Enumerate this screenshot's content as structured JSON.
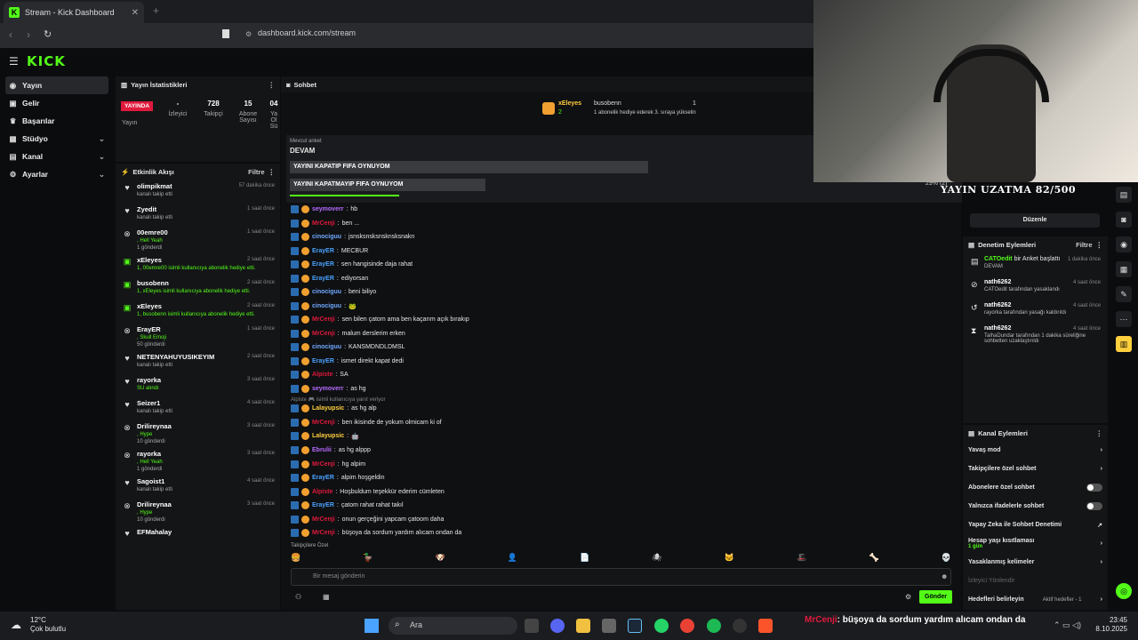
{
  "browser": {
    "tab_title": "Stream - Kick Dashboard",
    "url": "dashboard.kick.com/stream"
  },
  "brand": {
    "logo": "KICK",
    "accent": "#53fc18"
  },
  "nav": [
    {
      "label": "Yayın",
      "icon": "broadcast-icon",
      "active": true
    },
    {
      "label": "Gelir",
      "icon": "money-icon"
    },
    {
      "label": "Başarılar",
      "icon": "trophy-icon"
    },
    {
      "label": "Stüdyo",
      "icon": "studio-icon",
      "chevron": true
    },
    {
      "label": "Kanal",
      "icon": "channel-icon",
      "chevron": true
    },
    {
      "label": "Ayarlar",
      "icon": "gear-icon",
      "chevron": true
    }
  ],
  "stats": {
    "title": "Yayın İstatistikleri",
    "live_label": "YAYINDA",
    "live_sub": "Yayın",
    "viewers": {
      "value": "-",
      "label": "İzleyici"
    },
    "followers": {
      "value": "728",
      "label": "Takipçi"
    },
    "subs": {
      "value": "15",
      "label": "Abone Sayısı"
    },
    "extra": {
      "value": "04",
      "label": "Ya Ol Sü"
    }
  },
  "feed": {
    "title": "Etkinlik Akışı",
    "filter": "Filtre",
    "items": [
      {
        "name": "olimpikmat",
        "time": "57 dakika önce",
        "desc": "kanalı takip etti",
        "icon": "heart-icon"
      },
      {
        "name": "Zyedit",
        "time": "1 saat önce",
        "desc": "kanalı takip etti",
        "icon": "heart-icon"
      },
      {
        "name": "00emre00",
        "time": "1 saat önce",
        "desc": ", Hell Yeah",
        "extra": "1 gönderdi",
        "icon": "kick-icon",
        "green": true
      },
      {
        "name": "xEleyes",
        "time": "2 saat önce",
        "desc": "1, 00emre00 isimli kullanıcıya abonelik hediye etti.",
        "icon": "gift-icon",
        "green": true
      },
      {
        "name": "busobenn",
        "time": "2 saat önce",
        "desc": "1, xEleyes isimli kullanıcıya abonelik hediye etti.",
        "icon": "gift-icon",
        "green": true
      },
      {
        "name": "xEleyes",
        "time": "2 saat önce",
        "desc": "1, busobenn isimli kullanıcıya abonelik hediye etti.",
        "icon": "gift-icon",
        "green": true
      },
      {
        "name": "ErayER",
        "time": "1 saat önce",
        "desc": ", Skull Emoji",
        "extra": "50 gönderdi",
        "icon": "kick-icon",
        "green": true
      },
      {
        "name": "NETENYAHUYUSIKEYIM",
        "time": "2 saat önce",
        "desc": "kanalı takip etti",
        "icon": "heart-icon"
      },
      {
        "name": "rayorka",
        "time": "3 saat önce",
        "desc": "SU alındı",
        "icon": "heart-icon",
        "green": true
      },
      {
        "name": "Seizer1",
        "time": "4 saat önce",
        "desc": "kanalı takip etti",
        "icon": "heart-icon"
      },
      {
        "name": "Drilireynaa",
        "time": "3 saat önce",
        "desc": ", Hype",
        "extra": "10 gönderdi",
        "icon": "kick-icon",
        "green": true
      },
      {
        "name": "rayorka",
        "time": "3 saat önce",
        "desc": ", Hell Yeah",
        "extra": "1 gönderdi",
        "icon": "kick-icon",
        "green": true
      },
      {
        "name": "Sagoist1",
        "time": "4 saat önce",
        "desc": "kanalı takip etti",
        "icon": "heart-icon"
      },
      {
        "name": "Drilireynaa",
        "time": "3 saat önce",
        "desc": ", Hype",
        "extra": "10 gönderdi",
        "icon": "kick-icon",
        "green": true
      },
      {
        "name": "EFMahalay",
        "time": "",
        "desc": "",
        "icon": "heart-icon"
      }
    ]
  },
  "chat": {
    "title": "Sohbet",
    "pinned": {
      "user1": "xEleyes",
      "count1": "2",
      "user2": "busobenn",
      "count2": "1",
      "desc": "1 abonelik hediye ederek 3. sıraya yükselin"
    },
    "poll": {
      "label": "Mevcut anket",
      "status": "DEVAM",
      "opt1": "YAYINI KAPATIP FIFA OYNUYOM",
      "opt1_pct": 0.68,
      "opt2": "YAYINI KAPATMAYIP FIFA OYNUYOM",
      "opt2_pct": 0.29,
      "pct_label": "29% (2)"
    },
    "messages": [
      {
        "user": "seymoverr",
        "color": "#b56cff",
        "text": "hb"
      },
      {
        "user": "MrCenji",
        "color": "#e0193c",
        "text": "ben ..."
      },
      {
        "user": "cinociguu",
        "color": "#6fa8ff",
        "text": "jsnsksnsksnsknsksnakn"
      },
      {
        "user": "ErayER",
        "color": "#4aa3ff",
        "text": "MECBUR"
      },
      {
        "user": "ErayER",
        "color": "#4aa3ff",
        "text": "sen hangisinde daja rahat"
      },
      {
        "user": "ErayER",
        "color": "#4aa3ff",
        "text": "ediyorsan"
      },
      {
        "user": "cinociguu",
        "color": "#6fa8ff",
        "text": "beni biliyo"
      },
      {
        "user": "cinociguu",
        "color": "#6fa8ff",
        "text": "🐸"
      },
      {
        "user": "MrCenji",
        "color": "#e0193c",
        "text": "sen bilen çatom ama ben kaçarım açık bırakıp"
      },
      {
        "user": "MrCenji",
        "color": "#e0193c",
        "text": "malum derslerim erken"
      },
      {
        "user": "cinociguu",
        "color": "#6fa8ff",
        "text": "KANSMDNDLDMSL"
      },
      {
        "user": "ErayER",
        "color": "#4aa3ff",
        "text": "ismet direkt kapat dedi"
      },
      {
        "user": "Alpiste",
        "color": "#e0193c",
        "text": "SA"
      },
      {
        "user": "seymoverr",
        "color": "#b56cff",
        "text": "as hg"
      },
      {
        "user": "Lalayupsic",
        "color": "#ffcf3d",
        "text": "as hg alp"
      },
      {
        "user": "MrCenji",
        "color": "#e0193c",
        "text": "ben ikisinde de yokum olmicam ki of"
      },
      {
        "user": "Lalayupsic",
        "color": "#ffcf3d",
        "text": "🤖"
      },
      {
        "user": "Ebrulii",
        "color": "#b56cff",
        "text": "as hg alppp"
      },
      {
        "user": "MrCenji",
        "color": "#e0193c",
        "text": "hg alpim"
      },
      {
        "user": "ErayER",
        "color": "#4aa3ff",
        "text": "alpim hoşgeldin"
      },
      {
        "user": "Alpiste",
        "color": "#e0193c",
        "text": "Hoşbuldum teşekkür ederim cümleten"
      },
      {
        "user": "ErayER",
        "color": "#4aa3ff",
        "text": "çatom rahat rahat takıl"
      },
      {
        "user": "MrCenji",
        "color": "#e0193c",
        "text": "onun gerçeğini yapcam çatoom daha"
      },
      {
        "user": "MrCenji",
        "color": "#e0193c",
        "text": "büşoya da sordum yardım alıcam ondan da"
      }
    ],
    "reply_hint": "Alpiste 🎮 isimli kullanıcıya yanıt veriyor",
    "followers_only": "Takipçilere Özel",
    "input_placeholder": "Bir mesaj gönderin",
    "send": "Gönder"
  },
  "overlay": {
    "uzatma": "YAYIN UZATMA 82/500",
    "edit": "Düzenle"
  },
  "modlog": {
    "title": "Denetim Eylemleri",
    "filter": "Filtre",
    "items": [
      {
        "name": "CATOedit",
        "extra": "bir Anket başlattı",
        "time": "1 dakika önce",
        "desc": "DEVAM",
        "icon": "poll-icon",
        "color": "#53fc18"
      },
      {
        "name": "nath6262",
        "time": "4 saat önce",
        "desc": "CATOedit tarafından yasaklandı",
        "icon": "ban-icon",
        "color": "#fff"
      },
      {
        "name": "nath6262",
        "time": "4 saat önce",
        "desc": "rayorka tarafından yasağı kaldırıldı",
        "icon": "unban-icon",
        "color": "#fff"
      },
      {
        "name": "nath6262",
        "time": "4 saat önce",
        "desc": "TalhaDundar tarafından 1 dakika süreliğine sohbetten uzaklaştırıldı",
        "icon": "timeout-icon",
        "color": "#fff"
      }
    ]
  },
  "channel_actions": {
    "title": "Kanal Eylemleri",
    "items": [
      {
        "label": "Yavaş mod",
        "type": "chevron"
      },
      {
        "label": "Takipçilere özel sohbet",
        "type": "chevron"
      },
      {
        "label": "Abonelere özel sohbet",
        "type": "toggle"
      },
      {
        "label": "Yalnızca ifadelerle sohbet",
        "type": "toggle"
      },
      {
        "label": "Yapay Zeka ile Sohbet Denetimi",
        "type": "link"
      },
      {
        "label": "Hesap yaşı kısıtlaması",
        "sub": "1 gün",
        "type": "chevron"
      },
      {
        "label": "Yasaklanmış kelimeler",
        "type": "chevron"
      },
      {
        "label": "İzleyici Yönlendir",
        "type": "none"
      },
      {
        "label": "Hedefleri belirleyin",
        "extra": "Aktif hedefler - 1",
        "type": "chevron"
      }
    ]
  },
  "taskbar": {
    "temp": "12°C",
    "weather": "Çok bulutlu",
    "search": "Ara",
    "time": "23:45",
    "date": "8.10.2025",
    "ticker_user": "MrCenji",
    "ticker_text": ": büşoya da sordum yardım alıcam ondan da"
  }
}
